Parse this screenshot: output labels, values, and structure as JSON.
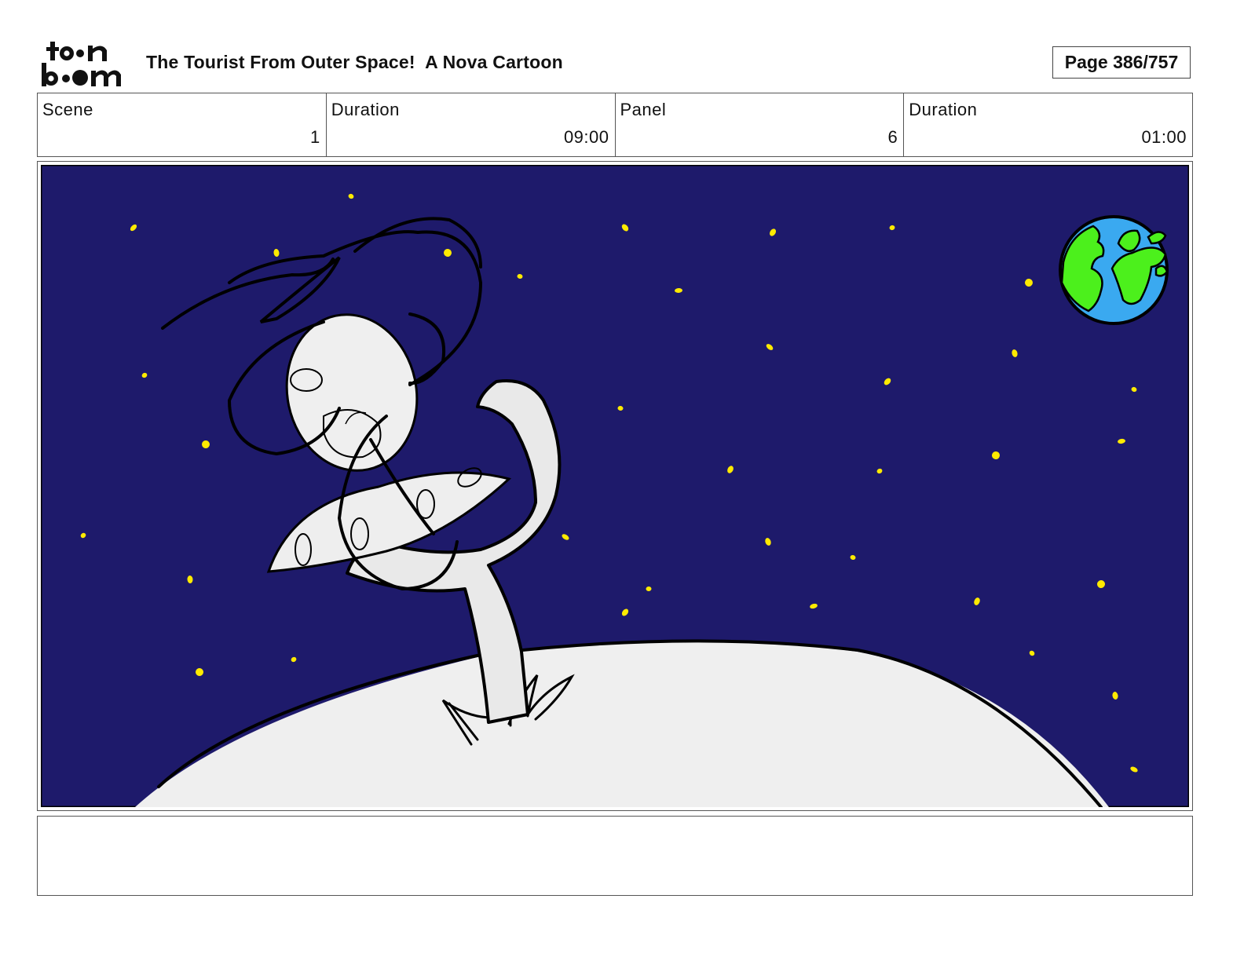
{
  "header": {
    "logo_alt": "toon boom",
    "title": "The Tourist From Outer Space!  A Nova Cartoon",
    "page": "Page 386/757"
  },
  "info": {
    "scene_label": "Scene",
    "scene_value": "1",
    "scene_duration_label": "Duration",
    "scene_duration_value": "09:00",
    "panel_label": "Panel",
    "panel_value": "6",
    "panel_duration_label": "Duration",
    "panel_duration_value": "01:00"
  },
  "panel": {
    "sky_color": "#1e1a6b",
    "star_color": "#ffea00",
    "moon_color": "#efefef",
    "earth_ocean_color": "#3aa9f0",
    "earth_land_color": "#4cf01c"
  },
  "caption": {
    "text": ""
  }
}
